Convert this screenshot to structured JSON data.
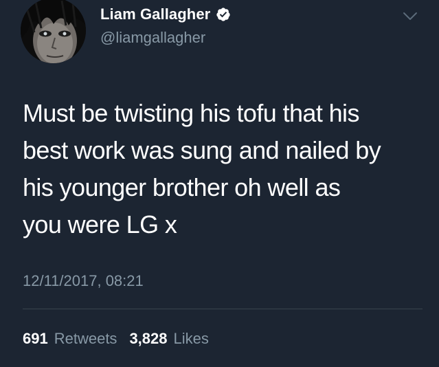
{
  "user": {
    "display_name": "Liam Gallagher",
    "handle": "@liamgallagher",
    "verified": true,
    "avatar": "profile-photo"
  },
  "tweet": {
    "text_lines": [
      "Must be twisting his tofu that his",
      "best work was sung and nailed by",
      "his younger brother oh well as",
      "you were LG x"
    ],
    "timestamp": "12/11/2017, 08:21"
  },
  "stats": {
    "retweets_count": "691",
    "retweets_label": "Retweets",
    "likes_count": "3,828",
    "likes_label": "Likes"
  },
  "icons": {
    "verified": "verified-badge-icon",
    "menu": "chevron-down-icon"
  },
  "colors": {
    "background": "#1c2532",
    "primary_text": "#ffffff",
    "secondary_text": "#8899a6",
    "divider": "#38444d"
  }
}
